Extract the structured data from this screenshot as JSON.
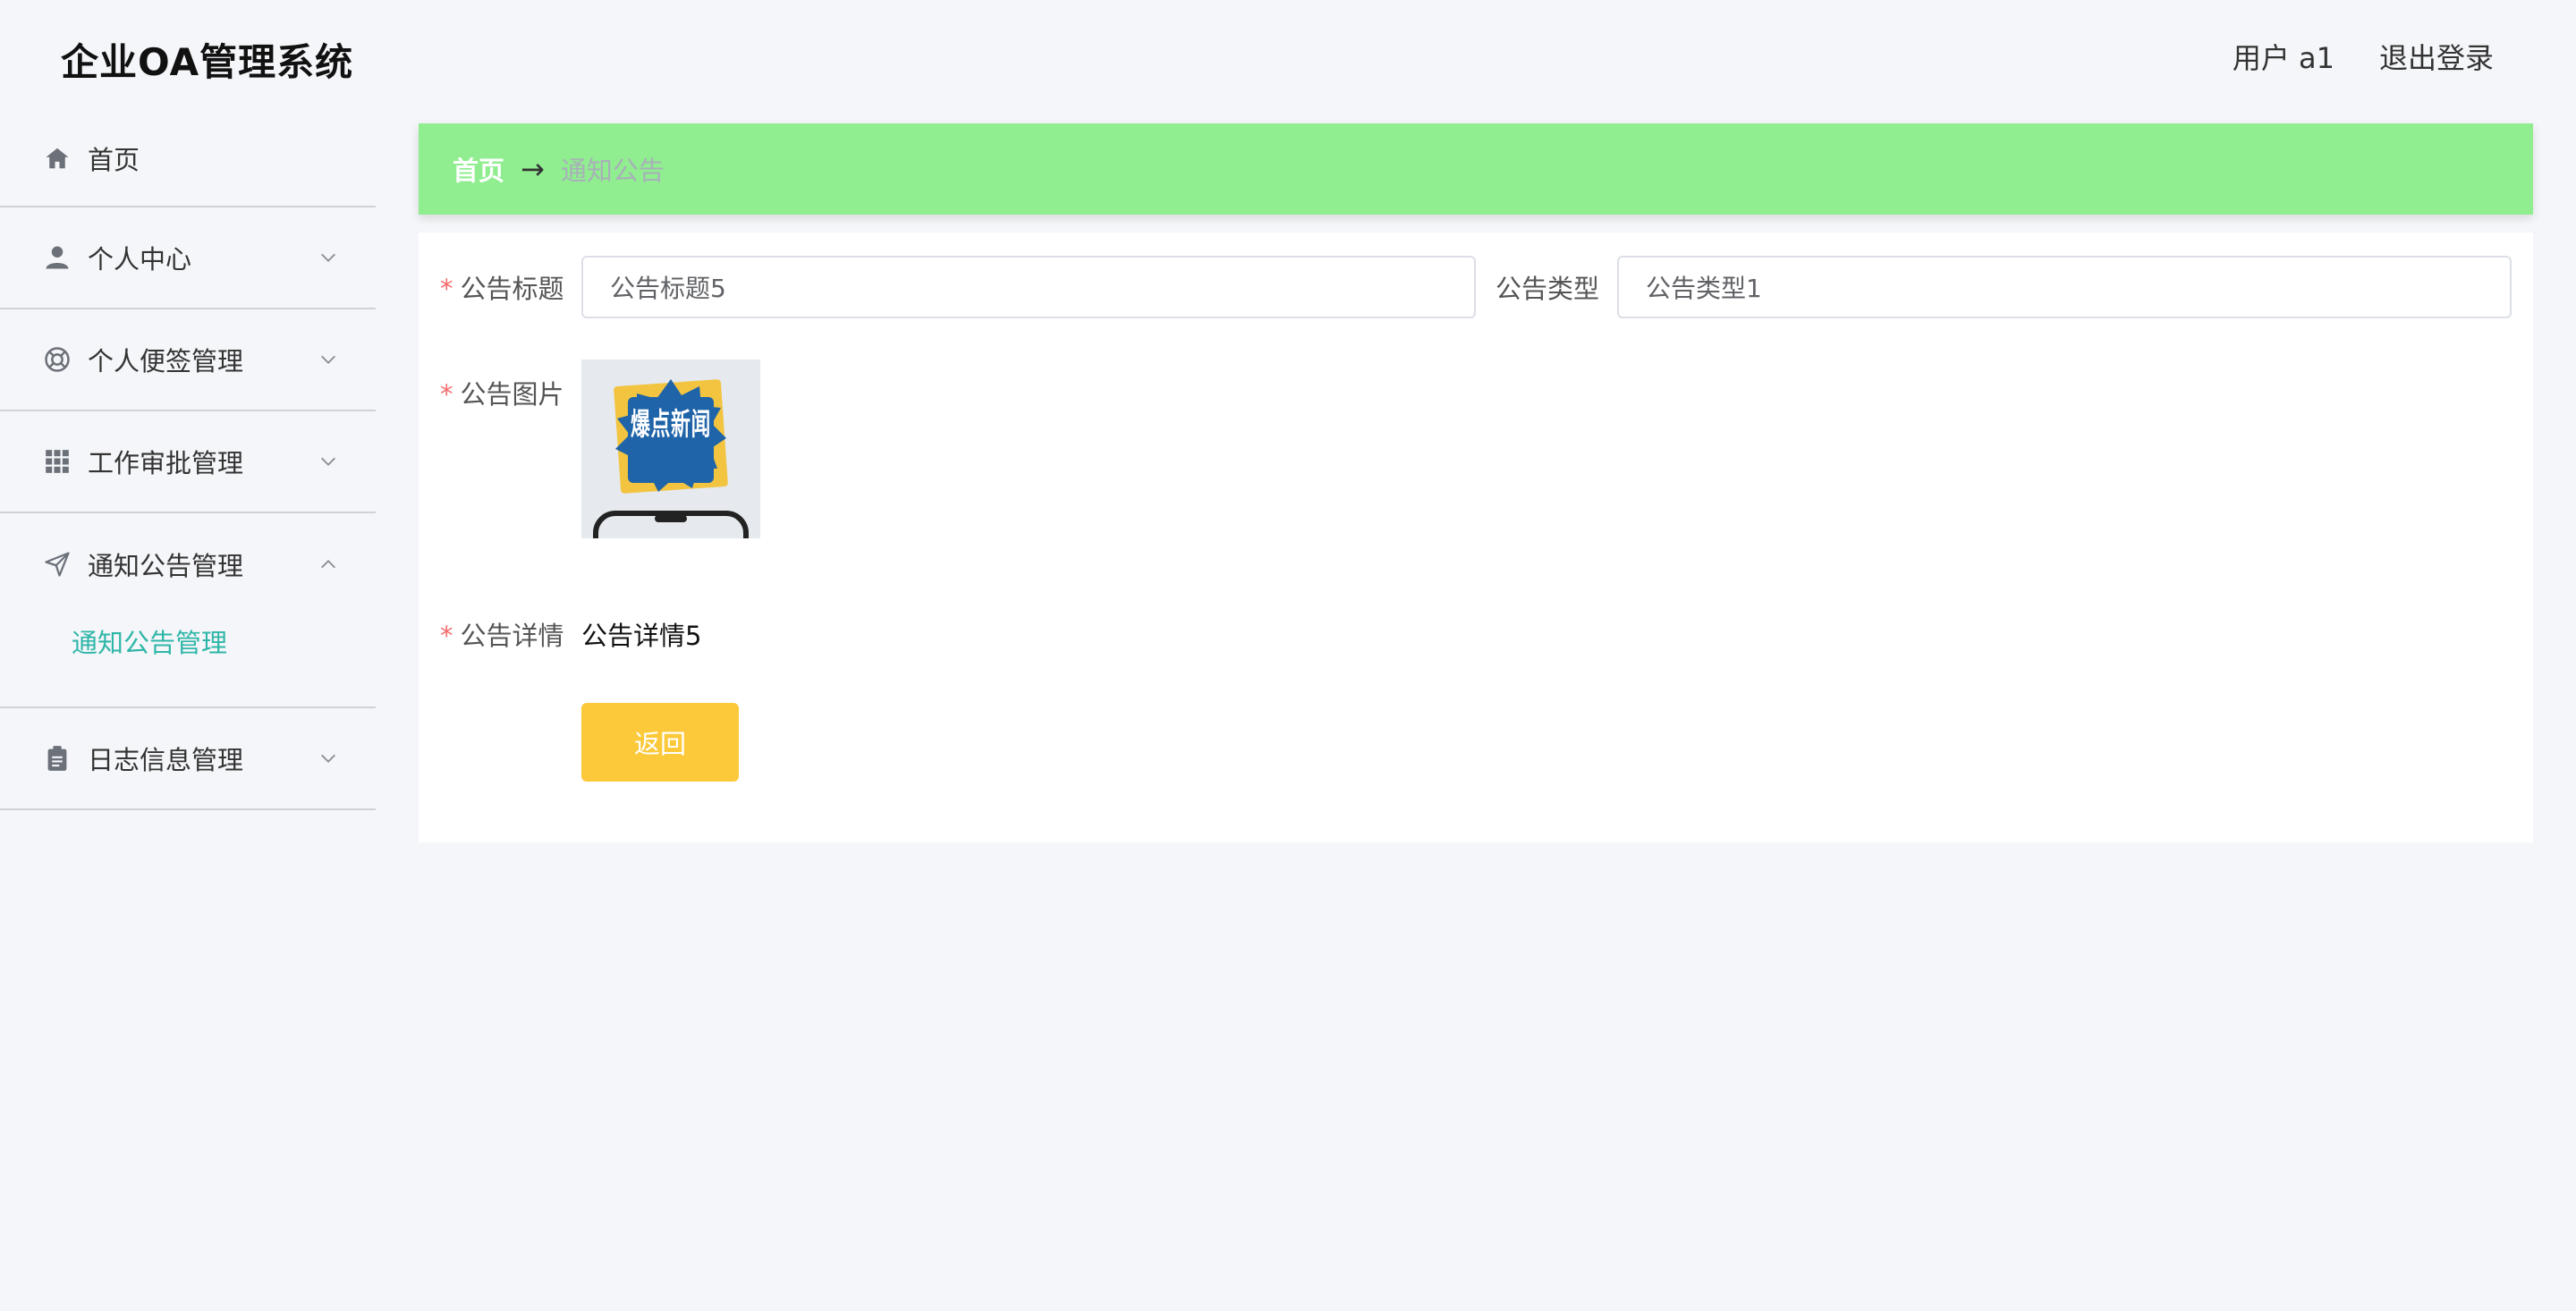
{
  "app": {
    "title": "企业OA管理系统"
  },
  "header": {
    "user_label": "用户 a1",
    "logout_label": "退出登录"
  },
  "sidebar": {
    "items": [
      {
        "label": "首页",
        "icon": "home-icon"
      },
      {
        "label": "个人中心",
        "icon": "user-icon"
      },
      {
        "label": "个人便签管理",
        "icon": "lifebuoy-icon"
      },
      {
        "label": "工作审批管理",
        "icon": "grid-icon"
      },
      {
        "label": "通知公告管理",
        "icon": "send-icon",
        "expanded": true,
        "children": [
          {
            "label": "通知公告管理",
            "active": true
          }
        ]
      },
      {
        "label": "日志信息管理",
        "icon": "clipboard-icon"
      }
    ]
  },
  "breadcrumb": {
    "home": "首页",
    "separator": "→",
    "current": "通知公告"
  },
  "form": {
    "title_label": "公告标题",
    "title_value": "公告标题5",
    "type_label": "公告类型",
    "type_value": "公告类型1",
    "image_label": "公告图片",
    "image_caption": "爆点新闻",
    "detail_label": "公告详情",
    "detail_value": "公告详情5",
    "required_mark": "*",
    "back_button": "返回"
  },
  "colors": {
    "breadcrumb_bg": "#90ee90",
    "accent_teal": "#2fb6a8",
    "button_yellow": "#fbc93a",
    "required_red": "#f56c6c"
  }
}
